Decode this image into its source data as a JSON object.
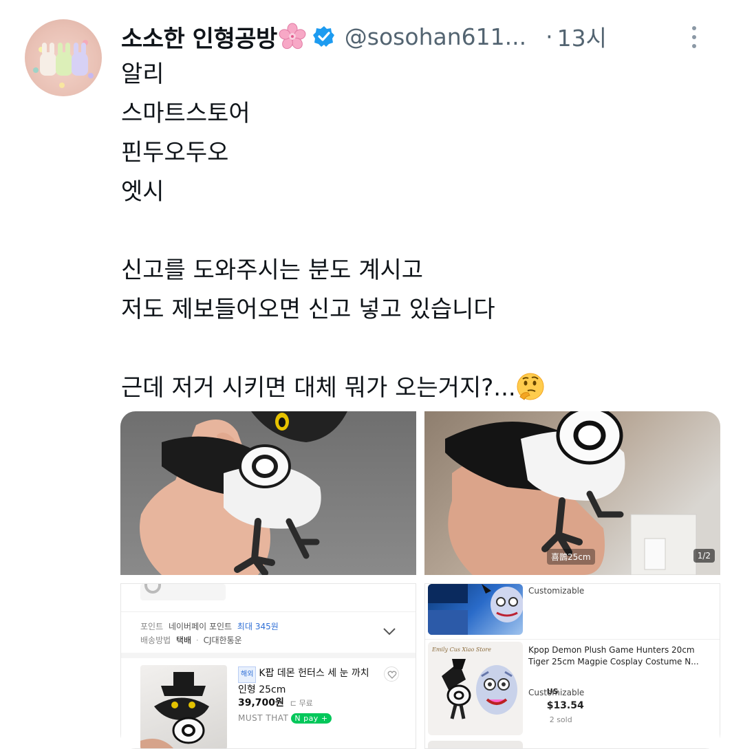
{
  "tweet": {
    "display_name": "소소한 인형공방",
    "handle": "@sosohan611...",
    "separator": "·",
    "time": "13시",
    "body": "알리\n스마트스토어\n핀두오두오\n엣시\n\n신고를 도와주시는 분도 계시고\n저도 제보들어오면 신고 넣고 있습니다\n\n근데 저거 시키면 대체 뭐가 오는거지?..."
  },
  "colors": {
    "verified": "#1d9bf0",
    "text_primary": "#0f1419",
    "text_secondary": "#536471",
    "naver_green": "#03c75a"
  },
  "icons": {
    "emoji_after_name": "cherry-blossom-icon",
    "verified": "verified-badge-icon",
    "more": "more-options-icon",
    "emoji_after_body": "thinking-face-icon"
  },
  "media": {
    "photo2_caption": "喜鵲25cm",
    "photo2_counter": "1/2",
    "shop_left": {
      "points_label": "포인트",
      "points_text": "네이버페이 포인트",
      "points_value": "최대 345원",
      "shipping_label": "배송방법",
      "shipping_type": "택배",
      "shipping_sep": "·",
      "shipping_company": "CJ대한통운",
      "overseas_tag": "해외",
      "product_title": "K팝 데몬 헌터스 세 눈 까치\n인형 25cm",
      "price": "39,700원",
      "delivery": "무료",
      "must_that": "MUST THAT",
      "npay": "N pay +"
    },
    "shop_right": {
      "customizable_top": "Customizable",
      "product_title": "Kpop Demon Plush Game Hunters 20cm\nTiger 25cm Magpie Cosplay Costume N...",
      "price_prefix": "US",
      "price": "$13.54",
      "sold": "2 sold",
      "customizable": "Customizable"
    }
  }
}
